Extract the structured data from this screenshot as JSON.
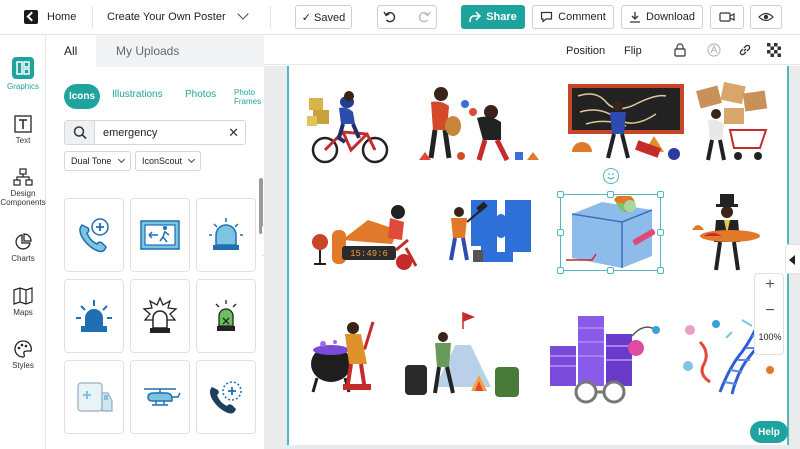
{
  "topbar": {
    "home_label": "Home",
    "doc_title": "Create Your Own Poster",
    "saved_label": "✓ Saved",
    "share_label": "Share",
    "comment_label": "Comment",
    "download_label": "Download",
    "brand_color": "#1fa39e"
  },
  "rail": {
    "items": [
      {
        "label": "Graphics",
        "icon": "graphics-icon",
        "active": true
      },
      {
        "label": "Text",
        "icon": "text-icon"
      },
      {
        "label": "Design Components",
        "icon": "design-components-icon"
      },
      {
        "label": "Charts",
        "icon": "charts-icon"
      },
      {
        "label": "Maps",
        "icon": "maps-icon"
      },
      {
        "label": "Styles",
        "icon": "styles-icon"
      }
    ]
  },
  "panel": {
    "tabs": [
      "All",
      "My Uploads"
    ],
    "subtabs": [
      "Icons",
      "Illustrations",
      "Photos",
      "Photo Frames"
    ],
    "search": {
      "value": "emergency"
    },
    "filters": [
      "Dual Tone",
      "IconScout"
    ],
    "icons": [
      "phone-plus-icon",
      "emergency-exit-icon",
      "siren-icon",
      "police-light-icon",
      "alarm-burst-icon",
      "alarm-box-icon",
      "ambulance-icon",
      "helicopter-icon",
      "emergency-call-icon"
    ]
  },
  "canvas": {
    "toolbar": {
      "position_label": "Position",
      "flip_label": "Flip"
    },
    "illustrations": [
      "courier-bicycle-illustration",
      "people-exchanging-illustration",
      "chalkboard-maze-illustration",
      "box-cart-illustration",
      "chair-clock-illustration",
      "puzzle-hammer-illustration",
      "cube-3d-illustration",
      "magician-illustration",
      "cauldron-illustration",
      "mountain-camp-illustration",
      "data-chart-illustration",
      "dna-science-illustration"
    ],
    "zoom_label": "100%",
    "help_label": "Help"
  }
}
